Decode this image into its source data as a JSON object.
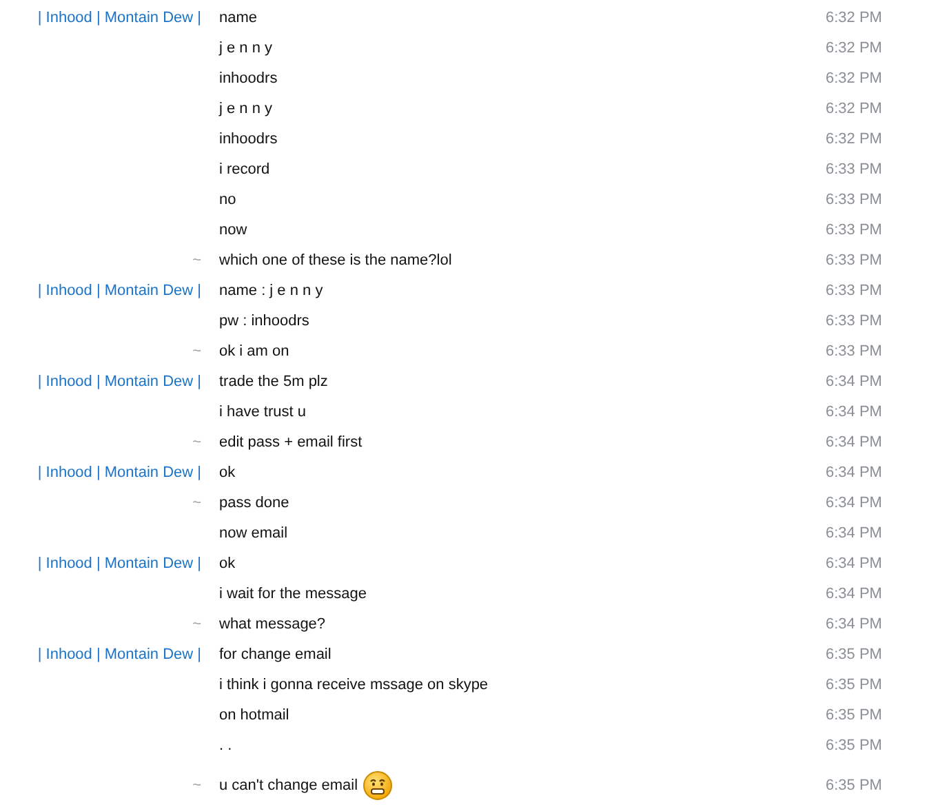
{
  "messages": [
    {
      "kind": "contact",
      "sender": "| Inhood | Montain Dew |",
      "text": "name",
      "time": "6:32 PM"
    },
    {
      "kind": "continued",
      "text": "j e n n y",
      "time": "6:32 PM"
    },
    {
      "kind": "continued",
      "text": "inhoodrs",
      "time": "6:32 PM"
    },
    {
      "kind": "continued",
      "text": "j e n n y",
      "time": "6:32 PM"
    },
    {
      "kind": "continued",
      "text": "inhoodrs",
      "time": "6:32 PM"
    },
    {
      "kind": "continued",
      "text": "i record",
      "time": "6:33 PM"
    },
    {
      "kind": "continued",
      "text": "no",
      "time": "6:33 PM"
    },
    {
      "kind": "continued",
      "text": "now",
      "time": "6:33 PM"
    },
    {
      "kind": "self",
      "sender": "~",
      "text": "which one of these is the name?lol",
      "time": "6:33 PM"
    },
    {
      "kind": "contact",
      "sender": "| Inhood | Montain Dew |",
      "text": "name : j e n n y",
      "time": "6:33 PM"
    },
    {
      "kind": "continued",
      "text": "pw : inhoodrs",
      "time": "6:33 PM"
    },
    {
      "kind": "self",
      "sender": "~",
      "text": "ok i am on",
      "time": "6:33 PM"
    },
    {
      "kind": "contact",
      "sender": "| Inhood | Montain Dew |",
      "text": "trade the 5m plz",
      "time": "6:34 PM"
    },
    {
      "kind": "continued",
      "text": "i have trust u",
      "time": "6:34 PM"
    },
    {
      "kind": "self",
      "sender": "~",
      "text": "edit pass + email first",
      "time": "6:34 PM"
    },
    {
      "kind": "contact",
      "sender": "| Inhood | Montain Dew |",
      "text": "ok",
      "time": "6:34 PM"
    },
    {
      "kind": "self",
      "sender": "~",
      "text": "pass done",
      "time": "6:34 PM"
    },
    {
      "kind": "continued",
      "text": "now email",
      "time": "6:34 PM"
    },
    {
      "kind": "contact",
      "sender": "| Inhood | Montain Dew |",
      "text": "ok",
      "time": "6:34 PM"
    },
    {
      "kind": "continued",
      "text": "i wait for the message",
      "time": "6:34 PM"
    },
    {
      "kind": "self",
      "sender": "~",
      "text": "what message?",
      "time": "6:34 PM"
    },
    {
      "kind": "contact",
      "sender": "| Inhood | Montain Dew |",
      "text": "for change email",
      "time": "6:35 PM"
    },
    {
      "kind": "continued",
      "text": "i think i gonna receive mssage on skype",
      "time": "6:35 PM"
    },
    {
      "kind": "continued",
      "text": "on hotmail",
      "time": "6:35 PM"
    },
    {
      "kind": "continued",
      "text": ". .",
      "time": "6:35 PM"
    },
    {
      "kind": "self",
      "sender": "~",
      "text": "u can't change email",
      "time": "6:35 PM",
      "emoticon": true
    }
  ]
}
